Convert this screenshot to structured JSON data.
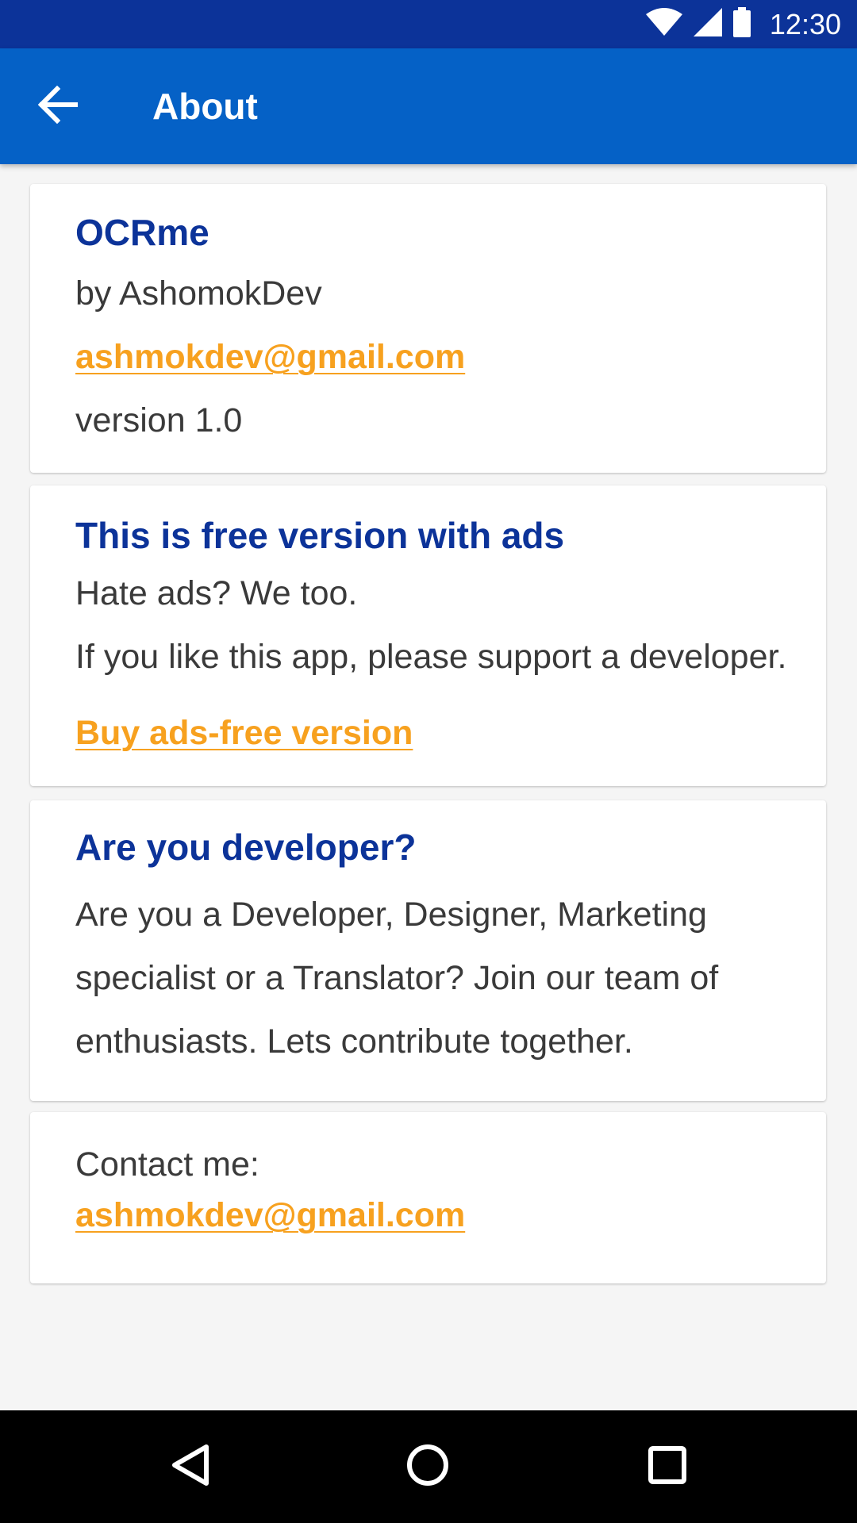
{
  "status_bar": {
    "time": "12:30",
    "icons": [
      "wifi-icon",
      "signal-icon",
      "battery-icon"
    ]
  },
  "app_bar": {
    "title": "About",
    "back_icon": "arrow-back-icon"
  },
  "app_info": {
    "name": "OCRme",
    "author": "by AshomokDev",
    "email": "ashmokdev@gmail.com",
    "version": "version 1.0"
  },
  "ads_card": {
    "heading": "This is free version with ads",
    "line1": "Hate ads? We too.",
    "line2": "If you like this app, please support a developer.",
    "buy_link": "Buy ads-free version"
  },
  "developer_card": {
    "heading": "Are you developer?",
    "text": "Are you a Developer, Designer, Marketing specialist or a Translator? Join our team of enthusiasts. Lets contribute together."
  },
  "contact_card": {
    "label": "Contact me:",
    "email": "ashmokdev@gmail.com"
  },
  "nav_bar": {
    "icons": [
      "back-triangle-icon",
      "home-circle-icon",
      "recents-square-icon"
    ]
  },
  "colors": {
    "status_bar": "#0c3399",
    "app_bar": "#0561c6",
    "heading": "#0c3399",
    "link": "#f7a11f",
    "background": "#f5f5f5"
  }
}
